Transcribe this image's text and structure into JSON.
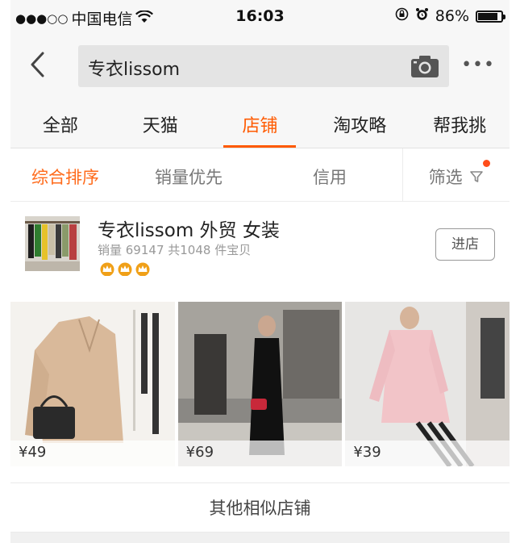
{
  "status_bar": {
    "signal": "●●●○○",
    "carrier": "中国电信",
    "time": "16:03",
    "battery": "86%",
    "battery_level": 0.86
  },
  "search": {
    "back_icon": "chevron-left-icon",
    "query": "专衣lissom",
    "camera_icon": "camera-icon",
    "more_icon": "more-icon",
    "more_label": "•••"
  },
  "tabs": [
    {
      "label": "全部"
    },
    {
      "label": "天猫"
    },
    {
      "label": "店铺"
    },
    {
      "label": "淘攻略"
    },
    {
      "label": "帮我挑"
    }
  ],
  "sort_options": [
    {
      "label": "综合排序"
    },
    {
      "label": "销量优先"
    },
    {
      "label": "信用"
    },
    {
      "label": "筛选"
    }
  ],
  "shop": {
    "name": "专衣lissom 外贸 女装",
    "meta": "销量 69147  共1048 件宝贝",
    "crowns": 3,
    "enter_label": "进店"
  },
  "products": [
    {
      "price": "¥49"
    },
    {
      "price": "¥69"
    },
    {
      "price": "¥39"
    }
  ],
  "similar_shops_label": "其他相似店铺",
  "colors": {
    "accent": "#ff5a00",
    "crown": "#f0a018"
  }
}
